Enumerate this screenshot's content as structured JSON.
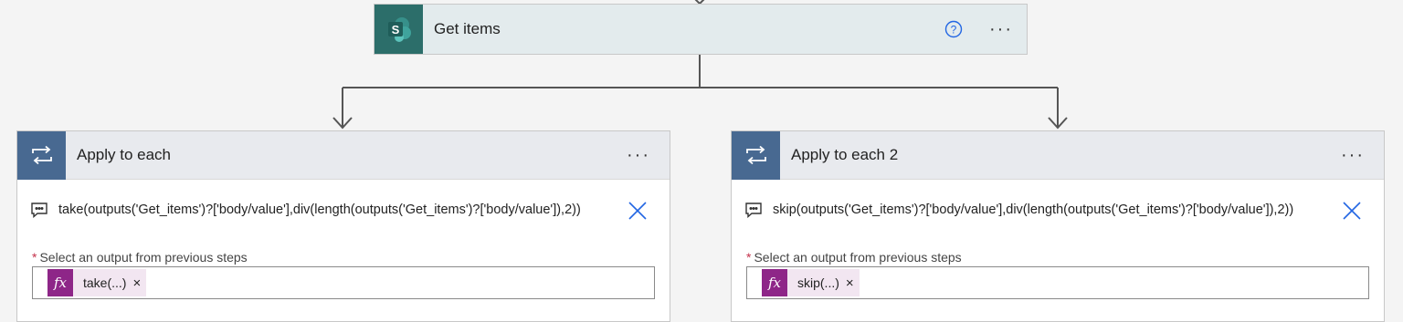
{
  "get_items": {
    "title": "Get items",
    "icon": "sharepoint-icon"
  },
  "apply_each_1": {
    "title": "Apply to each",
    "icon": "loop-icon",
    "comment": "take(outputs('Get_items')?['body/value'],div(length(outputs('Get_items')?['body/value']),2))",
    "field_required": "*",
    "field_label": "Select an output from previous steps",
    "token_icon_text": "fx",
    "token_label": "take(...)",
    "token_remove": "×"
  },
  "apply_each_2": {
    "title": "Apply to each 2",
    "icon": "loop-icon",
    "comment": "skip(outputs('Get_items')?['body/value'],div(length(outputs('Get_items')?['body/value']),2))",
    "field_required": "*",
    "field_label": "Select an output from previous steps",
    "token_icon_text": "fx",
    "token_label": "skip(...)",
    "token_remove": "×"
  },
  "menu_glyph": "···",
  "colors": {
    "sharepoint_tile": "#2c6e6a",
    "loop_tile": "#486991",
    "expression_tile": "#8e2688",
    "help_blue": "#2266e3",
    "close_blue": "#2266e3"
  }
}
